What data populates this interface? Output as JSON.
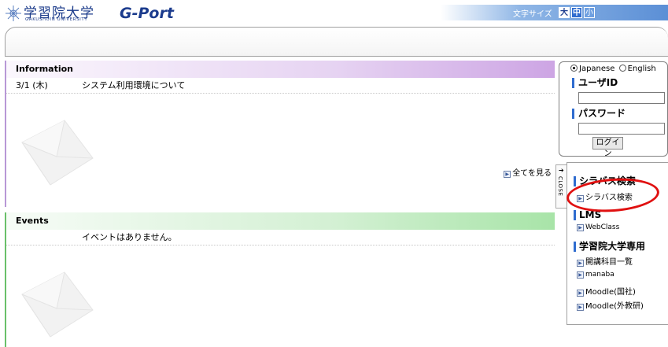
{
  "header": {
    "logo_jp": "学習院大学",
    "logo_en": "GAKUSHUIN UNIVERSITY",
    "brand": "G-Port",
    "fontsize_label": "文字サイズ",
    "fontsize_large": "大",
    "fontsize_medium": "中",
    "fontsize_small": "小"
  },
  "information": {
    "title": "Information",
    "items": [
      {
        "date": "3/1 (木)",
        "title": "システム利用環境について"
      }
    ],
    "see_all": "全てを見る"
  },
  "events": {
    "title": "Events",
    "empty_message": "イベントはありません。"
  },
  "login": {
    "lang_japanese": "Japanese",
    "lang_english": "English",
    "user_label": "ユーザID",
    "password_label": "パスワード",
    "login_button": "ログイン"
  },
  "sidebar": {
    "close_tab": "CLOSE",
    "sections": {
      "syllabus": {
        "title": "シラバス検索",
        "links": [
          "シラバス検索"
        ]
      },
      "lms": {
        "title": "LMS",
        "links": [
          "WebClass"
        ]
      },
      "gakushuin": {
        "title": "学習院大学専用",
        "links": [
          "開講科目一覧",
          "manaba",
          "Moodle(国社)",
          "Moodle(外教研)"
        ]
      }
    }
  },
  "colors": {
    "brand_blue": "#1b3b8d",
    "info_accent": "#b898d6",
    "events_accent": "#6ac06a",
    "annotation_red": "#e01010"
  }
}
